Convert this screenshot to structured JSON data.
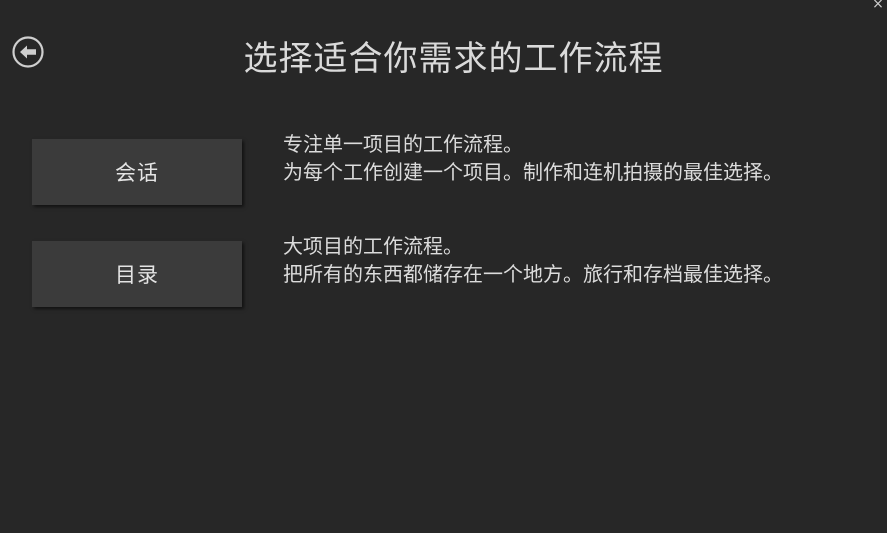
{
  "window": {
    "close_glyph": "×"
  },
  "header": {
    "back_icon": "back-arrow-circle-icon",
    "title": "选择适合你需求的工作流程"
  },
  "options": [
    {
      "label": "会话",
      "description_line1": "专注单一项目的工作流程。",
      "description_line2": "为每个工作创建一个项目。制作和连机拍摄的最佳选择。"
    },
    {
      "label": "目录",
      "description_line1": "大项目的工作流程。",
      "description_line2": "把所有的东西都储存在一个地方。旅行和存档最佳选择。"
    }
  ],
  "colors": {
    "background": "#272727",
    "button_bg": "#3b3b3b",
    "text": "#dcdcdc"
  }
}
